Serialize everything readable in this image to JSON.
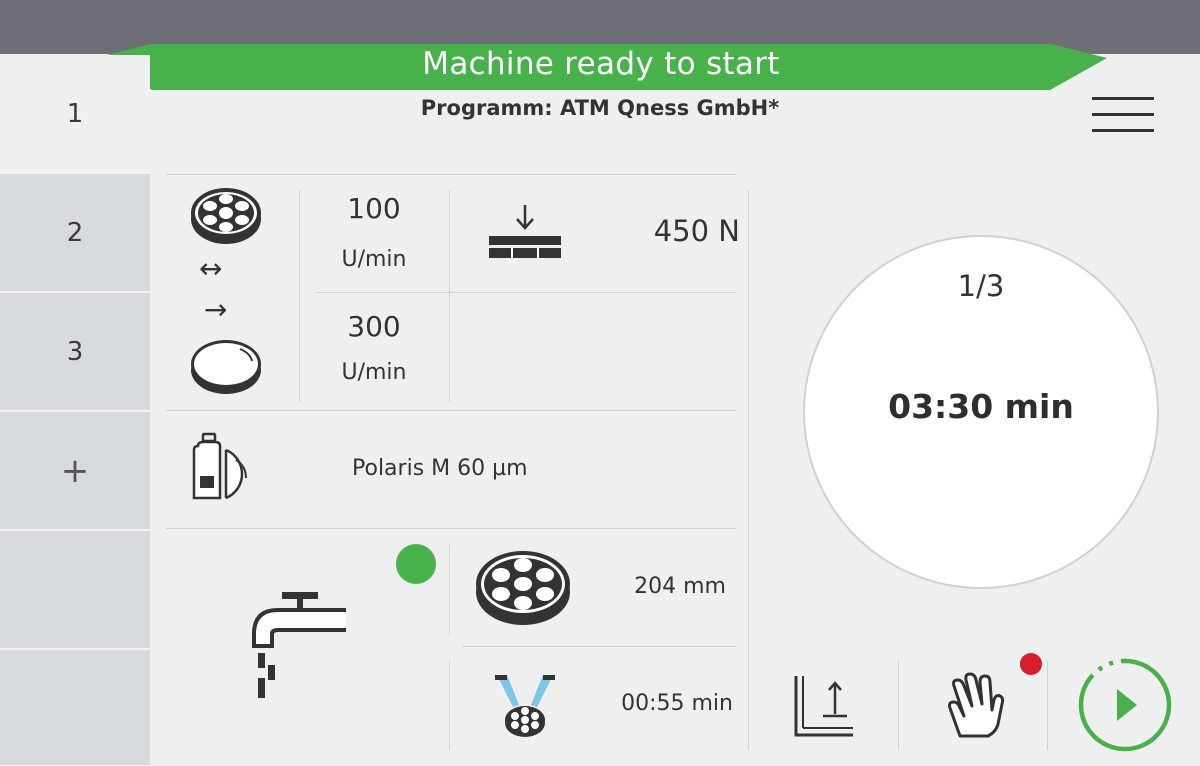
{
  "status": {
    "text": "Machine ready to start",
    "color": "#47b14a"
  },
  "program": {
    "label": "Programm: ATM Qness GmbH*"
  },
  "sidebar": {
    "tabs": [
      {
        "label": "1"
      },
      {
        "label": "2"
      },
      {
        "label": "3"
      },
      {
        "label": "+"
      },
      {
        "label": ""
      },
      {
        "label": ""
      }
    ]
  },
  "rotation": {
    "head_speed": {
      "value": "100",
      "unit": "U/min"
    },
    "platen_speed": {
      "value": "300",
      "unit": "U/min"
    },
    "direction_head": "↔",
    "direction_platen": "→"
  },
  "force": {
    "value": "450 N"
  },
  "suspension": {
    "name": "Polaris M 60 µm"
  },
  "water": {
    "status_color": "#47b14a"
  },
  "holder": {
    "diameter": "204 mm"
  },
  "rinse": {
    "time": "00:55 min"
  },
  "process": {
    "step": "1/3",
    "time": "03:30 min"
  },
  "bottom_bar": {
    "manual_indicator_color": "#d81e2a",
    "start_color": "#47b14a"
  },
  "icons": {
    "menu": "hamburger-menu-icon",
    "holder": "specimen-holder-icon",
    "platen": "platen-disc-icon",
    "force": "force-press-icon",
    "suspension": "suspension-bottle-icon",
    "water": "water-tap-icon",
    "rinse": "rinse-spray-icon",
    "profile": "force-profile-icon",
    "manual": "hand-icon",
    "start": "play-start-icon"
  }
}
